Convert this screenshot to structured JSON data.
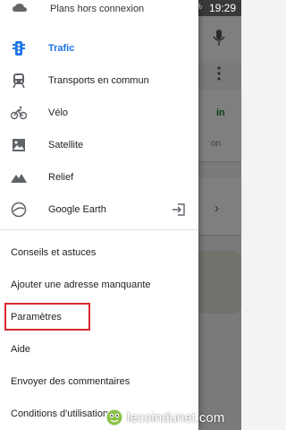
{
  "status_bar": {
    "time": "19:29",
    "battery": "74%"
  },
  "drawer": {
    "offline_label": "Plans hors connexion",
    "layers": [
      {
        "id": "trafic",
        "label": "Trafic",
        "icon": "traffic-icon",
        "active": true
      },
      {
        "id": "transports",
        "label": "Transports en commun",
        "icon": "train-icon",
        "active": false
      },
      {
        "id": "velo",
        "label": "Vélo",
        "icon": "bike-icon",
        "active": false
      },
      {
        "id": "satellite",
        "label": "Satellite",
        "icon": "satellite-icon",
        "active": false
      },
      {
        "id": "relief",
        "label": "Relief",
        "icon": "terrain-icon",
        "active": false
      },
      {
        "id": "google-earth",
        "label": "Google Earth",
        "icon": "globe-icon",
        "active": false,
        "trailing_icon": "open-external-icon"
      }
    ],
    "links": [
      {
        "id": "conseils",
        "label": "Conseils et astuces"
      },
      {
        "id": "ajouter",
        "label": "Ajouter une adresse manquante"
      },
      {
        "id": "parametres",
        "label": "Paramètres"
      },
      {
        "id": "aide",
        "label": "Aide"
      },
      {
        "id": "commentaires",
        "label": "Envoyer des commentaires"
      },
      {
        "id": "conditions",
        "label": "Conditions d'utilisation"
      }
    ]
  },
  "background": {
    "green_text": "in",
    "grey_text": "on"
  },
  "watermark": {
    "text": "lecoindunet.com"
  },
  "colors": {
    "accent": "#1a73e8",
    "highlight": "#d9272e"
  }
}
